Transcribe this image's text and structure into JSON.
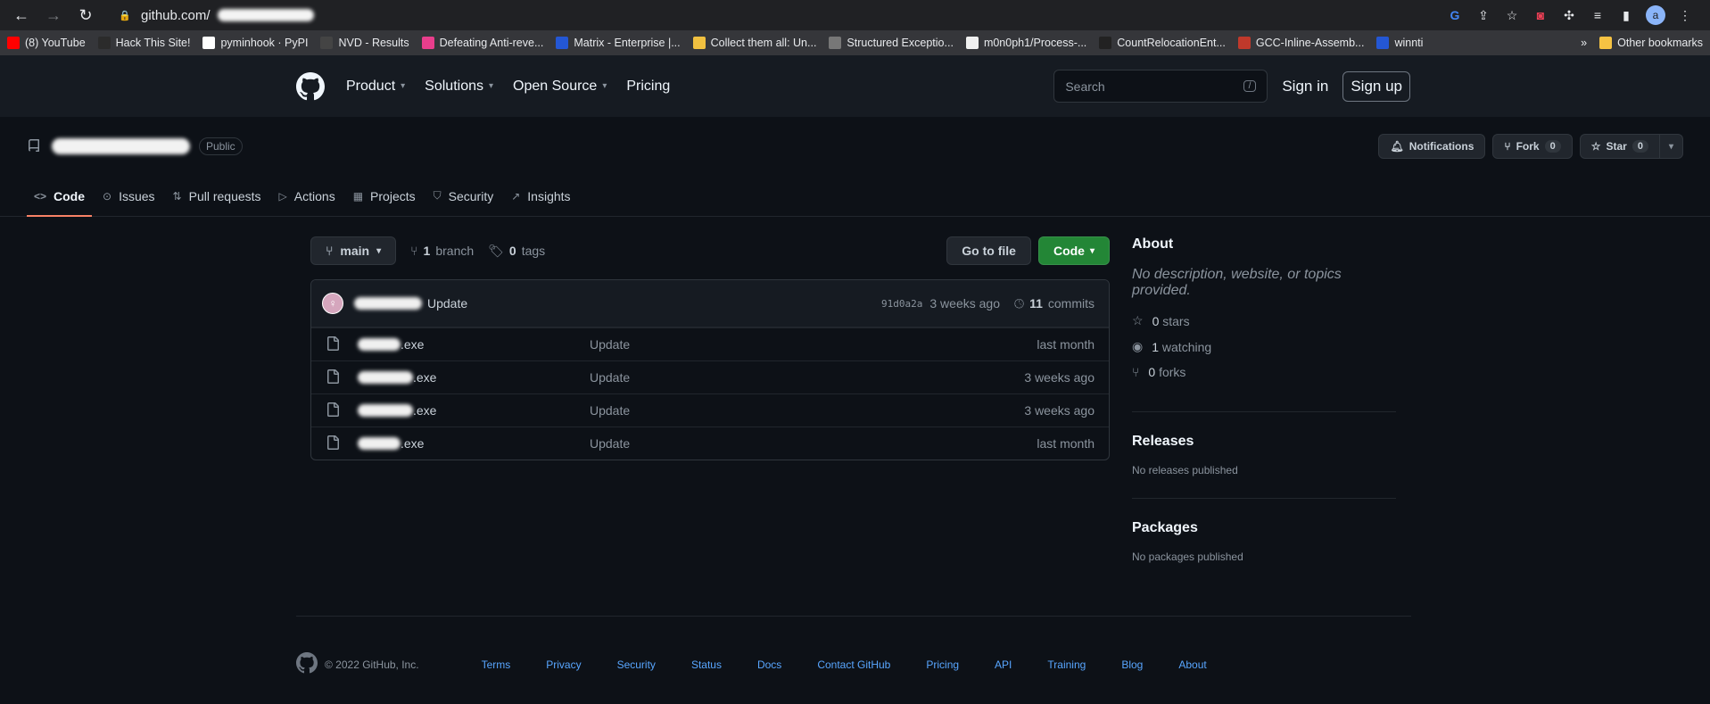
{
  "browser": {
    "url": "github.com/",
    "avatar_letter": "a",
    "bookmarks": [
      {
        "label": "(8) YouTube",
        "color": "#ff0000"
      },
      {
        "label": "Hack This Site!",
        "color": "#2b2b2b"
      },
      {
        "label": "pyminhook · PyPI",
        "color": "#ffffff"
      },
      {
        "label": "NVD - Results",
        "color": "#444444"
      },
      {
        "label": "Defeating Anti-reve...",
        "color": "#e83e8c"
      },
      {
        "label": "Matrix - Enterprise |...",
        "color": "#2457d4"
      },
      {
        "label": "Collect them all: Un...",
        "color": "#f0c040"
      },
      {
        "label": "Structured Exceptio...",
        "color": "#777777"
      },
      {
        "label": "m0n0ph1/Process-...",
        "color": "#f0f0f0"
      },
      {
        "label": "CountRelocationEnt...",
        "color": "#222222"
      },
      {
        "label": "GCC-Inline-Assemb...",
        "color": "#c0392b"
      },
      {
        "label": "winnti",
        "color": "#2457d4"
      }
    ],
    "more": "»",
    "other_bookmarks": "Other bookmarks"
  },
  "header": {
    "nav": [
      "Product",
      "Solutions",
      "Open Source",
      "Pricing"
    ],
    "search_placeholder": "Search",
    "search_shortcut": "/",
    "sign_in": "Sign in",
    "sign_up": "Sign up"
  },
  "repo": {
    "visibility": "Public",
    "notifications": "Notifications",
    "fork_label": "Fork",
    "fork_count": "0",
    "star_label": "Star",
    "star_count": "0"
  },
  "tabs": [
    "Code",
    "Issues",
    "Pull requests",
    "Actions",
    "Projects",
    "Security",
    "Insights"
  ],
  "code": {
    "branch": "main",
    "branches_count": "1",
    "branches_label": "branch",
    "tags_count": "0",
    "tags_label": "tags",
    "go_to_file": "Go to file",
    "code_button": "Code",
    "commit": {
      "message": "Update",
      "sha": "91d0a2a",
      "age": "3 weeks ago",
      "commits_count": "11",
      "commits_label": "commits"
    },
    "files": [
      {
        "ext": ".exe",
        "message": "Update",
        "age": "last month"
      },
      {
        "ext": ".exe",
        "message": "Update",
        "age": "3 weeks ago"
      },
      {
        "ext": ".exe",
        "message": "Update",
        "age": "3 weeks ago"
      },
      {
        "ext": ".exe",
        "message": "Update",
        "age": "last month"
      }
    ]
  },
  "sidebar": {
    "about_title": "About",
    "about_desc": "No description, website, or topics provided.",
    "stars_count": "0",
    "stars_label": "stars",
    "watching_count": "1",
    "watching_label": "watching",
    "forks_count": "0",
    "forks_label": "forks",
    "releases_title": "Releases",
    "releases_desc": "No releases published",
    "packages_title": "Packages",
    "packages_desc": "No packages published"
  },
  "footer": {
    "copyright": "© 2022 GitHub, Inc.",
    "links": [
      "Terms",
      "Privacy",
      "Security",
      "Status",
      "Docs",
      "Contact GitHub",
      "Pricing",
      "API",
      "Training",
      "Blog",
      "About"
    ]
  }
}
